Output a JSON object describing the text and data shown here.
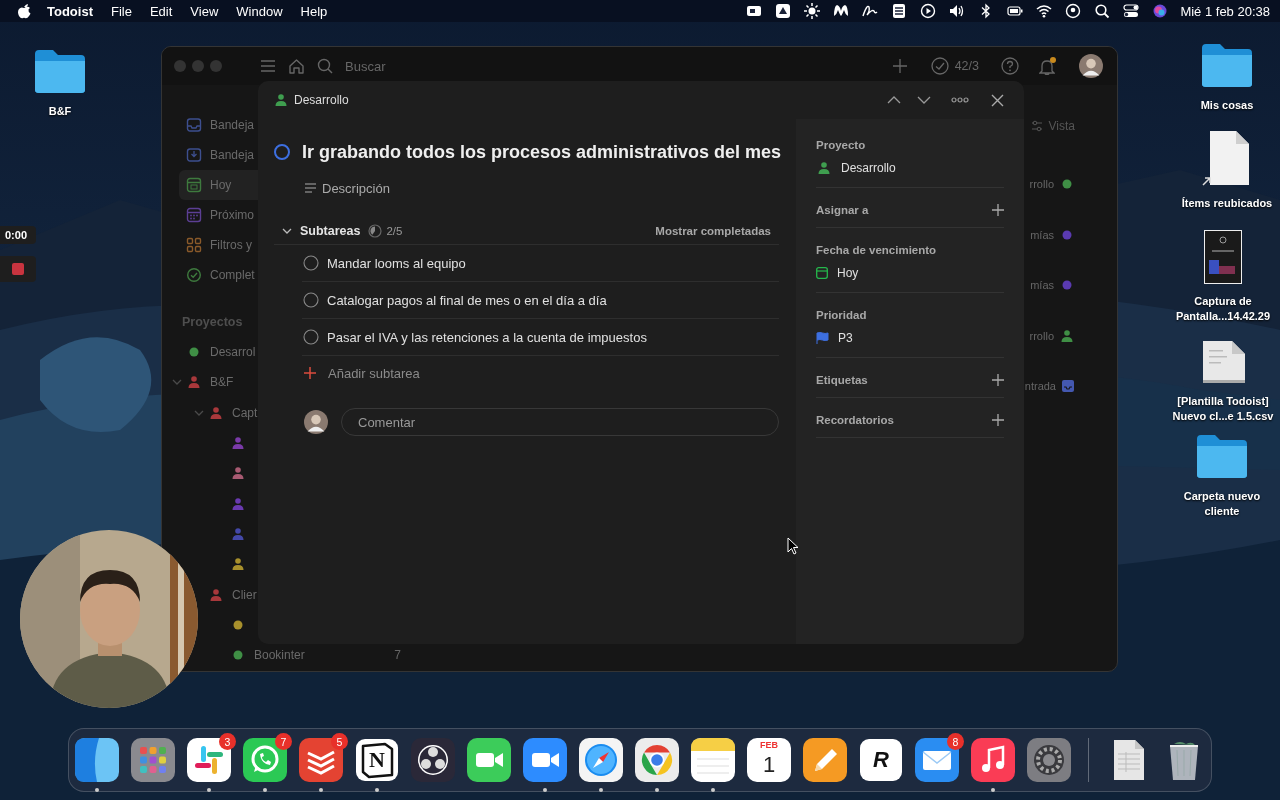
{
  "menu_bar": {
    "app_name": "Todoist",
    "menus": [
      "File",
      "Edit",
      "View",
      "Window",
      "Help"
    ],
    "clock": "Mié 1 feb 20:38"
  },
  "desktop_icons": [
    {
      "label": "B&F",
      "kind": "folder"
    },
    {
      "label": "Mis cosas",
      "kind": "folder"
    },
    {
      "label": "Ítems reubicados",
      "kind": "alias"
    },
    {
      "label": "Captura de Pantalla...14.42.29",
      "kind": "screenshot"
    },
    {
      "label": "[Plantilla Todoist] Nuevo cl...e 1.5.csv",
      "kind": "csv"
    },
    {
      "label": "Carpeta nuevo cliente",
      "kind": "folder"
    }
  ],
  "recorder": {
    "timer": "0:00"
  },
  "todoist": {
    "search": {
      "placeholder": "Buscar"
    },
    "completed_count": "42/3",
    "notifications_unread": true,
    "sidebar": {
      "items": [
        {
          "label": "Bandeja",
          "selected": false
        },
        {
          "label": "Bandeja",
          "selected": false
        },
        {
          "label": "Hoy",
          "selected": true
        },
        {
          "label": "Próximo",
          "selected": false
        },
        {
          "label": "Filtros y",
          "selected": false
        },
        {
          "label": "Complet",
          "selected": false
        }
      ],
      "projects_heading": "Proyectos",
      "projects": [
        {
          "label": "Desarrol",
          "kind": "dot",
          "color": "#3f8f45"
        },
        {
          "label": "B&F",
          "kind": "person",
          "color": "#a8383b",
          "expanded": true,
          "children": [
            {
              "label": "Capt",
              "kind": "person",
              "color": "#a8383b",
              "expanded": true,
              "children": [
                {
                  "kind": "person",
                  "color": "#7a3aa8"
                },
                {
                  "kind": "person",
                  "color": "#a85a72"
                },
                {
                  "kind": "person",
                  "color": "#6a3ab0"
                },
                {
                  "kind": "person",
                  "color": "#4448a8"
                },
                {
                  "kind": "person",
                  "color": "#a8902c"
                }
              ]
            },
            {
              "label": "Clier",
              "kind": "person",
              "color": "#a8383b",
              "children": [
                {
                  "kind": "dot",
                  "color": "#a8902c"
                },
                {
                  "label": "Bookinter",
                  "kind": "dot",
                  "color": "#3f8f45",
                  "count": "7"
                }
              ]
            }
          ]
        }
      ]
    },
    "view_button": "Vista",
    "list_fragments": [
      {
        "text": "rrollo",
        "kind": "dot",
        "color": "#3f8f45"
      },
      {
        "text": "mías",
        "kind": "dot",
        "color": "#5a3ab0"
      },
      {
        "text": "mías",
        "kind": "dot",
        "color": "#5a3ab0"
      },
      {
        "text": "rrollo",
        "kind": "person",
        "color": "#3f8f45"
      },
      {
        "text": "ntrada",
        "kind": "inbox",
        "color": "#4458b0"
      }
    ]
  },
  "task": {
    "project": "Desarrollo",
    "completed": false,
    "title": "Ir grabando todos los procesos administrativos del mes",
    "description_placeholder": "Descripción",
    "subtasks": {
      "heading": "Subtareas",
      "expanded": true,
      "progress": "2/5",
      "level": 0.4,
      "show_completed": "Mostrar completadas",
      "items": [
        {
          "title": "Mandar looms al equipo",
          "checked": false
        },
        {
          "title": "Catalogar pagos al final de mes o en el día a día",
          "checked": false
        },
        {
          "title": "Pasar el IVA y las retenciones a la cuenta de impuestos",
          "checked": false
        }
      ],
      "add_label": "Añadir subtarea"
    },
    "comment": {
      "placeholder": "Comentar"
    },
    "details": [
      {
        "label": "Proyecto",
        "kind": "project",
        "value": "Desarrollo"
      },
      {
        "label": "Asignar a",
        "kind": "add"
      },
      {
        "label": "Fecha de vencimiento",
        "kind": "date",
        "value": "Hoy"
      },
      {
        "label": "Prioridad",
        "kind": "priority",
        "value": "P3",
        "color": "#3d6fe0"
      },
      {
        "label": "Etiquetas",
        "kind": "add"
      },
      {
        "label": "Recordatorios",
        "kind": "add"
      }
    ]
  },
  "dock": {
    "items": [
      {
        "running": true
      },
      {
        "running": false
      },
      {
        "running": true,
        "badge": "3"
      },
      {
        "running": true,
        "badge": "7"
      },
      {
        "running": true,
        "badge": "5"
      },
      {
        "running": true,
        "logo_letter": "N"
      },
      {
        "running": false
      },
      {
        "running": false
      },
      {
        "running": true
      },
      {
        "running": true
      },
      {
        "running": true
      },
      {
        "running": true
      },
      {
        "running": false,
        "month": "FEB",
        "day": "1"
      },
      {
        "running": false
      },
      {
        "running": false,
        "logo_letter": "R"
      },
      {
        "running": false,
        "badge": "8"
      },
      {
        "running": true
      },
      {
        "running": false
      },
      {
        "running": false
      },
      {
        "running": false
      }
    ]
  }
}
